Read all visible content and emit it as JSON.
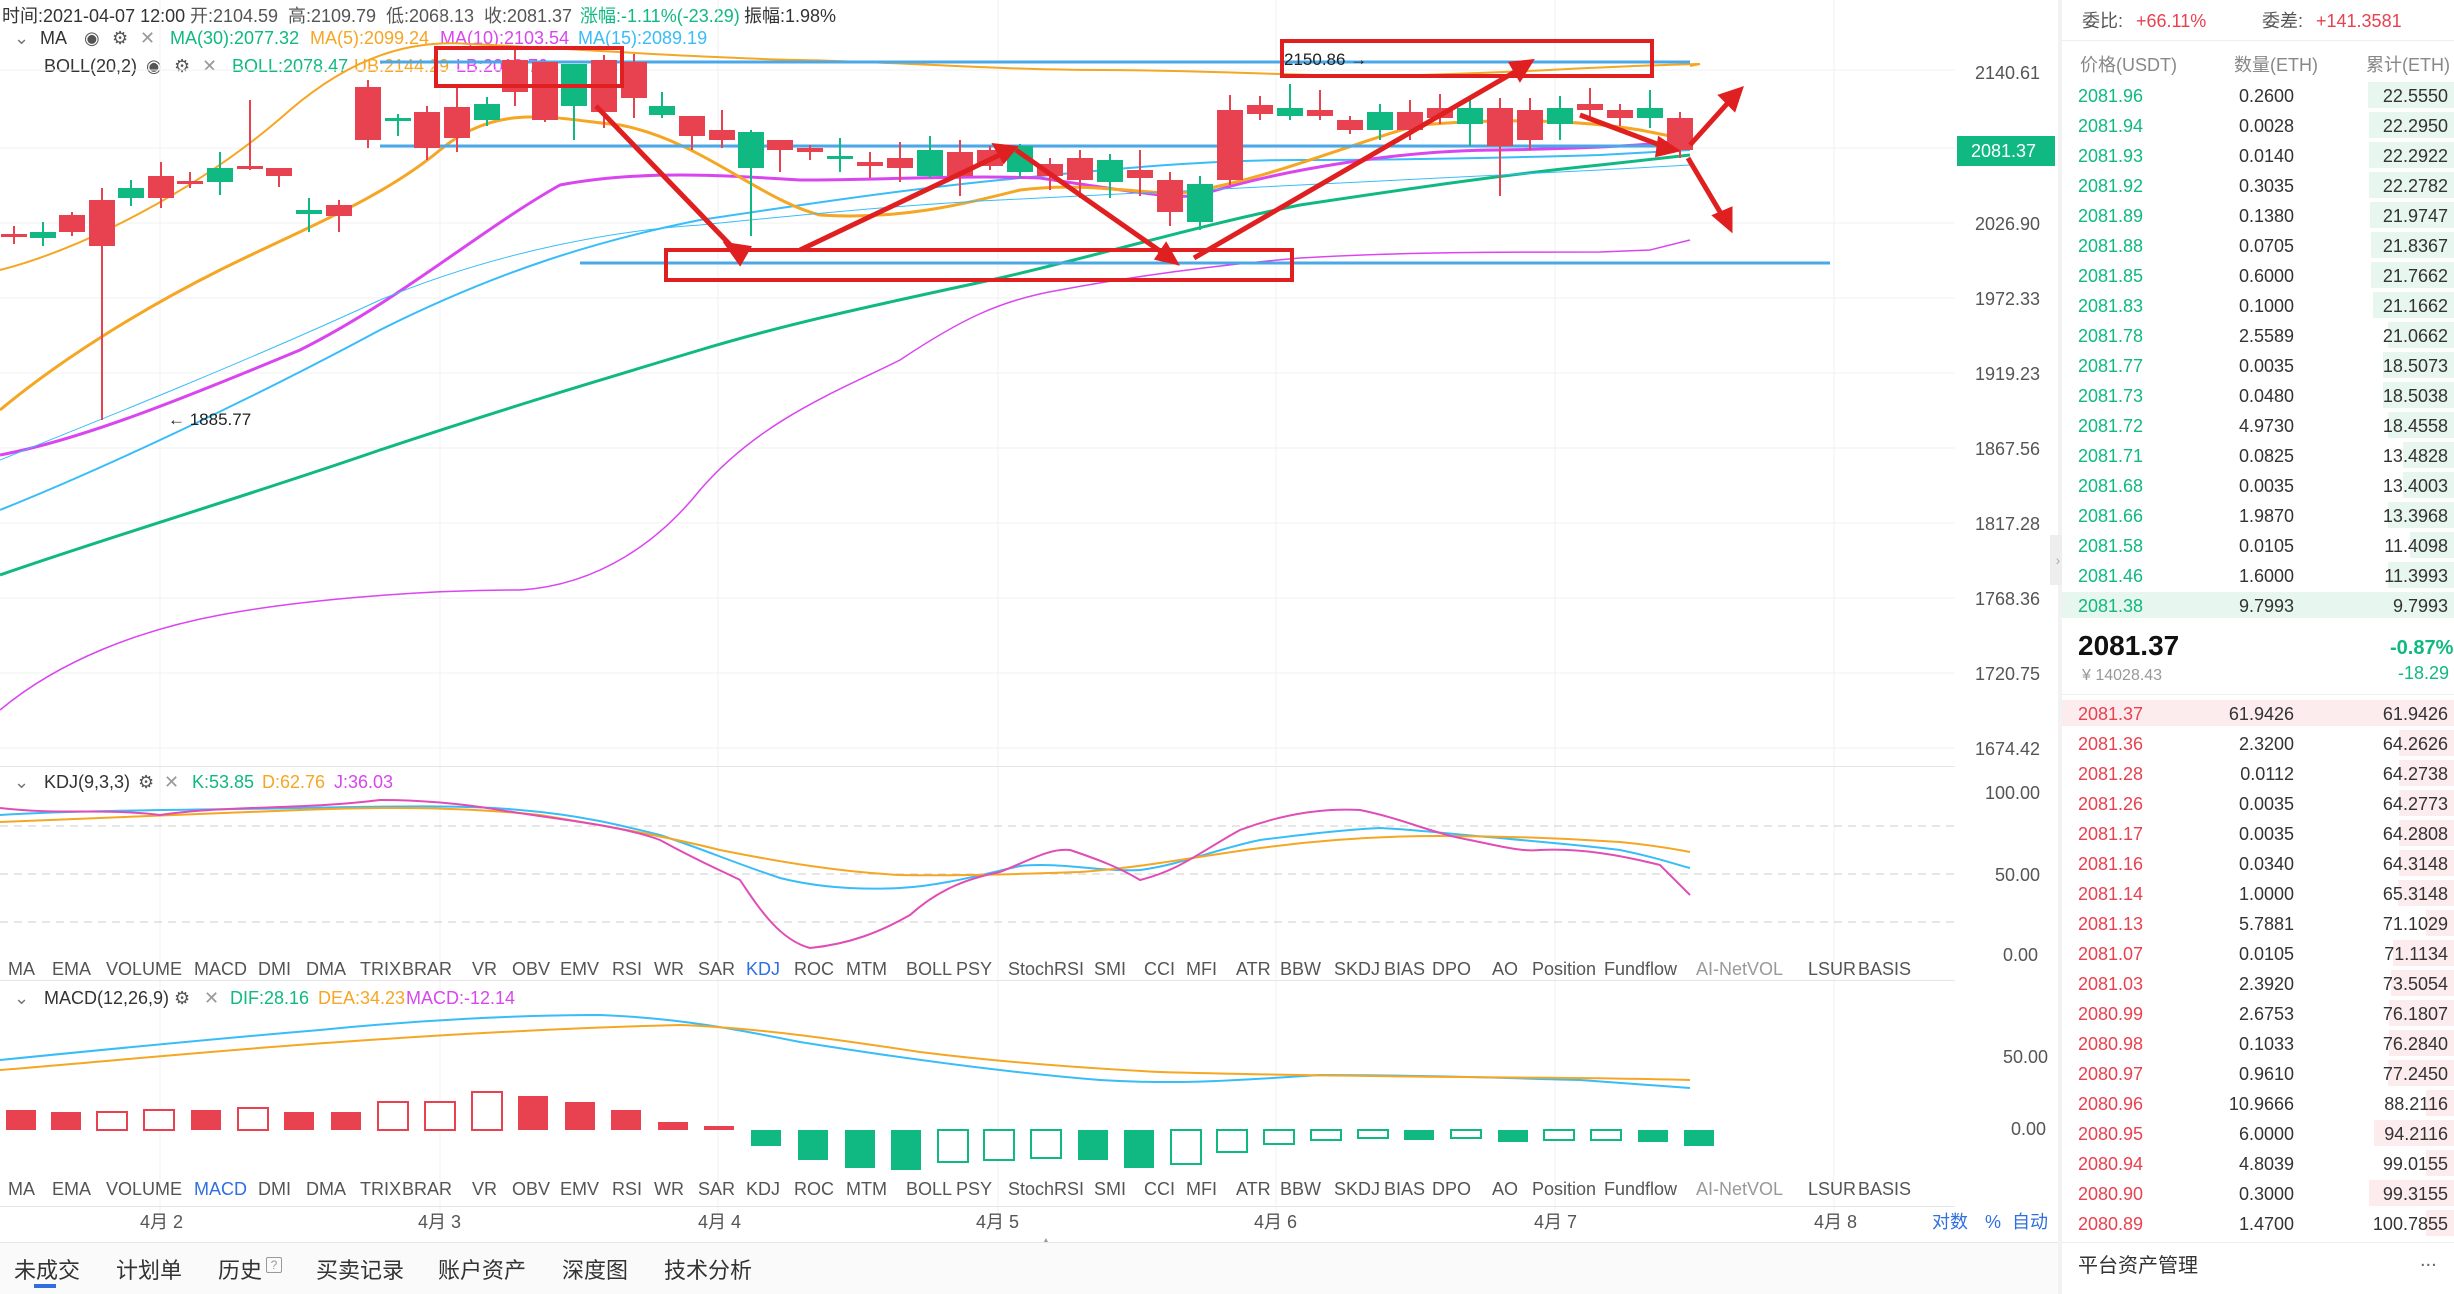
{
  "header": {
    "time": "时间:2021-04-07 12:00",
    "open": "开:2104.59",
    "high": "高:2109.79",
    "low": "低:2068.13",
    "close": "收:2081.37",
    "change": "涨幅:-1.11%(-23.29)",
    "amplitude": "振幅:1.98%"
  },
  "ma_legend": {
    "name": "MA",
    "ma30": "MA(30):2077.32",
    "ma5": "MA(5):2099.24",
    "ma10": "MA(10):2103.54",
    "ma15": "MA(15):2089.19"
  },
  "boll_legend": {
    "name": "BOLL(20,2)",
    "boll": "BOLL:2078.47",
    "ub": "UB:2144.29",
    "lb": "LB:2012.70"
  },
  "kdj_legend": {
    "name": "KDJ(9,3,3)",
    "k": "K:53.85",
    "d": "D:62.76",
    "j": "J:36.03"
  },
  "macd_legend": {
    "name": "MACD(12,26,9)",
    "dif": "DIF:28.16",
    "dea": "DEA:34.23",
    "macd": "MACD:-12.14"
  },
  "price_axis": [
    "2140.61",
    "2081.37",
    "2026.90",
    "1972.33",
    "1919.23",
    "1867.56",
    "1817.28",
    "1768.36",
    "1720.75",
    "1674.42"
  ],
  "kdj_axis": [
    "100.00",
    "50.00",
    "0.00"
  ],
  "macd_axis": [
    "50.00",
    "0.00"
  ],
  "annotations": {
    "high": "2150.86 →",
    "low": "← 1885.77"
  },
  "indicator_tabs": [
    "MA",
    "EMA",
    "VOLUME",
    "MACD",
    "DMI",
    "DMA",
    "TRIX",
    "BRAR",
    "VR",
    "OBV",
    "EMV",
    "RSI",
    "WR",
    "SAR",
    "KDJ",
    "ROC",
    "MTM",
    "BOLL",
    "PSY",
    "StochRSI",
    "SMI",
    "CCI",
    "MFI",
    "ATR",
    "BBW",
    "SKDJ",
    "BIAS",
    "DPO",
    "AO",
    "Position",
    "Fundflow",
    "AI-NetVOL",
    "LSUR",
    "BASIS"
  ],
  "date_axis": [
    "4月 2",
    "4月 3",
    "4月 4",
    "4月 5",
    "4月 6",
    "4月 7",
    "4月 8"
  ],
  "scale_options": {
    "log": "对数",
    "percent": "%",
    "auto": "自动"
  },
  "bottom_tabs": [
    "未成交",
    "计划单",
    "历史",
    "买卖记录",
    "账户资产",
    "深度图",
    "技术分析"
  ],
  "orderbook": {
    "ratio_label": "委比:",
    "ratio_value": "+66.11%",
    "diff_label": "委差:",
    "diff_value": "+141.3581",
    "col_price": "价格(USDT)",
    "col_qty": "数量(ETH)",
    "col_total": "累计(ETH)",
    "bids": [
      [
        "2081.96",
        "0.2600",
        "22.5550"
      ],
      [
        "2081.94",
        "0.0028",
        "22.2950"
      ],
      [
        "2081.93",
        "0.0140",
        "22.2922"
      ],
      [
        "2081.92",
        "0.3035",
        "22.2782"
      ],
      [
        "2081.89",
        "0.1380",
        "21.9747"
      ],
      [
        "2081.88",
        "0.0705",
        "21.8367"
      ],
      [
        "2081.85",
        "0.6000",
        "21.7662"
      ],
      [
        "2081.83",
        "0.1000",
        "21.1662"
      ],
      [
        "2081.78",
        "2.5589",
        "21.0662"
      ],
      [
        "2081.77",
        "0.0035",
        "18.5073"
      ],
      [
        "2081.73",
        "0.0480",
        "18.5038"
      ],
      [
        "2081.72",
        "4.9730",
        "18.4558"
      ],
      [
        "2081.71",
        "0.0825",
        "13.4828"
      ],
      [
        "2081.68",
        "0.0035",
        "13.4003"
      ],
      [
        "2081.66",
        "1.9870",
        "13.3968"
      ],
      [
        "2081.58",
        "0.0105",
        "11.4098"
      ],
      [
        "2081.46",
        "1.6000",
        "11.3993"
      ],
      [
        "2081.38",
        "9.7993",
        "9.7993"
      ]
    ],
    "last_price": "2081.37",
    "last_change": "-0.87%",
    "last_cny": "¥ 14028.43",
    "last_diff": "-18.29",
    "asks": [
      [
        "2081.37",
        "61.9426",
        "61.9426"
      ],
      [
        "2081.36",
        "2.3200",
        "64.2626"
      ],
      [
        "2081.28",
        "0.0112",
        "64.2738"
      ],
      [
        "2081.26",
        "0.0035",
        "64.2773"
      ],
      [
        "2081.17",
        "0.0035",
        "64.2808"
      ],
      [
        "2081.16",
        "0.0340",
        "64.3148"
      ],
      [
        "2081.14",
        "1.0000",
        "65.3148"
      ],
      [
        "2081.13",
        "5.7881",
        "71.1029"
      ],
      [
        "2081.07",
        "0.0105",
        "71.1134"
      ],
      [
        "2081.03",
        "2.3920",
        "73.5054"
      ],
      [
        "2080.99",
        "2.6753",
        "76.1807"
      ],
      [
        "2080.98",
        "0.1033",
        "76.2840"
      ],
      [
        "2080.97",
        "0.9610",
        "77.2450"
      ],
      [
        "2080.96",
        "10.9666",
        "88.2116"
      ],
      [
        "2080.95",
        "6.0000",
        "94.2116"
      ],
      [
        "2080.94",
        "4.8039",
        "99.0155"
      ],
      [
        "2080.90",
        "0.3000",
        "99.3155"
      ],
      [
        "2080.89",
        "1.4700",
        "100.7855"
      ]
    ],
    "footer": "平台资产管理",
    "more": "..."
  },
  "colors": {
    "up": "#e8414f",
    "down": "#10b981",
    "ma30": "#10b981",
    "ma5": "#f5a623",
    "ma10": "#d946ef",
    "ma15": "#38bdf8",
    "boll": "#3aa7e8",
    "annot": "#e02020"
  }
}
